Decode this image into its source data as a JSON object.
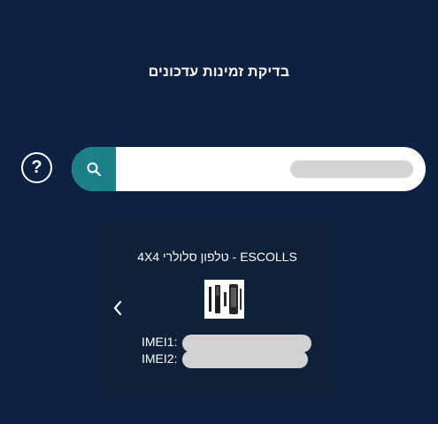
{
  "page": {
    "title": "בדיקת זמינות עדכונים"
  },
  "help": {
    "label": "?"
  },
  "search": {
    "placeholder": "",
    "value": ""
  },
  "device": {
    "title": "ESCOLLS - טלפון סלולרי 4X4",
    "imei1_label": "IMEI1:",
    "imei2_label": "IMEI2:"
  },
  "icons": {
    "search": "search-icon",
    "help": "question-icon",
    "prev": "chevron-left-icon"
  },
  "colors": {
    "background": "#0d2240",
    "card": "#0f2138",
    "accent": "#1d7f8a",
    "redaction": "#d3d3d3"
  }
}
